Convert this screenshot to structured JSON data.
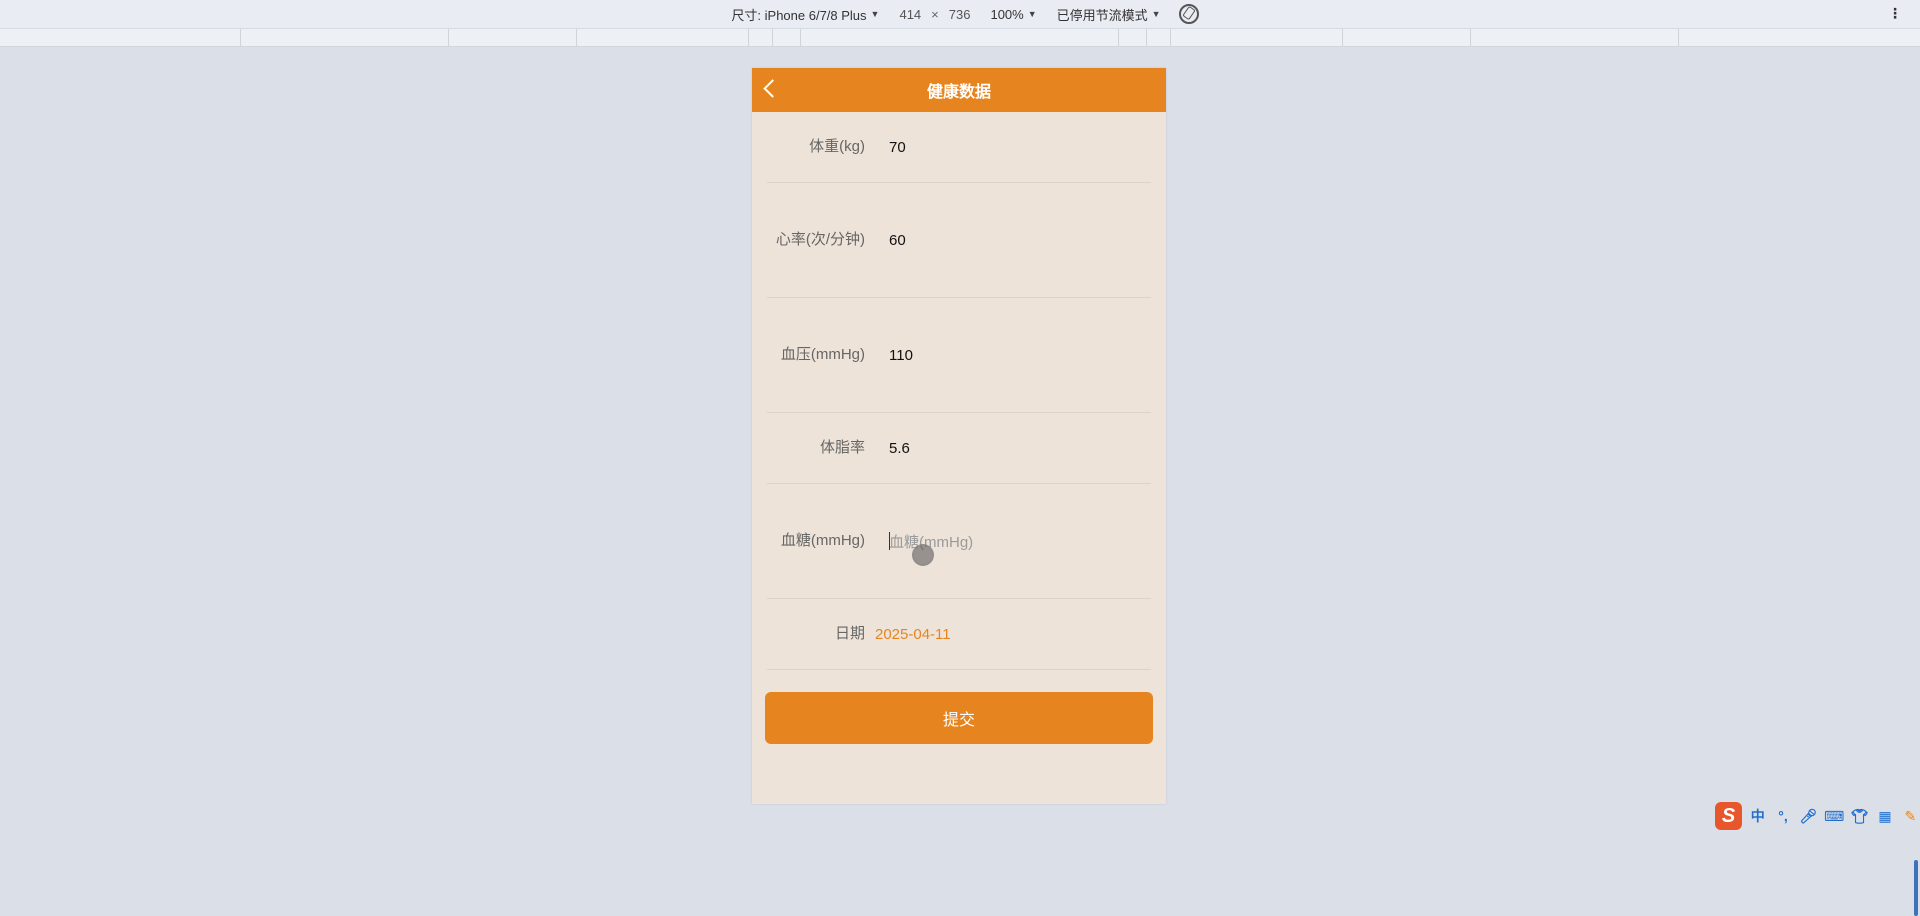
{
  "devtools": {
    "size_label": "尺寸: iPhone 6/7/8 Plus",
    "width": "414",
    "times": "×",
    "height": "736",
    "zoom": "100%",
    "throttle": "已停用节流模式"
  },
  "app": {
    "title": "健康数据",
    "fields": [
      {
        "label": "体重(kg)",
        "value": "70"
      },
      {
        "label": "心率(次/分钟)",
        "value": "60"
      },
      {
        "label": "血压(mmHg)",
        "value": "110"
      },
      {
        "label": "体脂率",
        "value": "5.6"
      },
      {
        "label": "血糖(mmHg)",
        "placeholder": "血糖(mmHg)"
      },
      {
        "label": "日期",
        "value": "2025-04-11"
      }
    ],
    "submit_label": "提交"
  },
  "ime": {
    "logo": "S",
    "items": [
      "中",
      "°,",
      "mic-icon",
      "keyboard-icon",
      "shirt-icon",
      "grid-icon",
      "tools-icon"
    ]
  },
  "colors": {
    "accent": "#e6851f",
    "page_bg": "#eee3d9"
  }
}
